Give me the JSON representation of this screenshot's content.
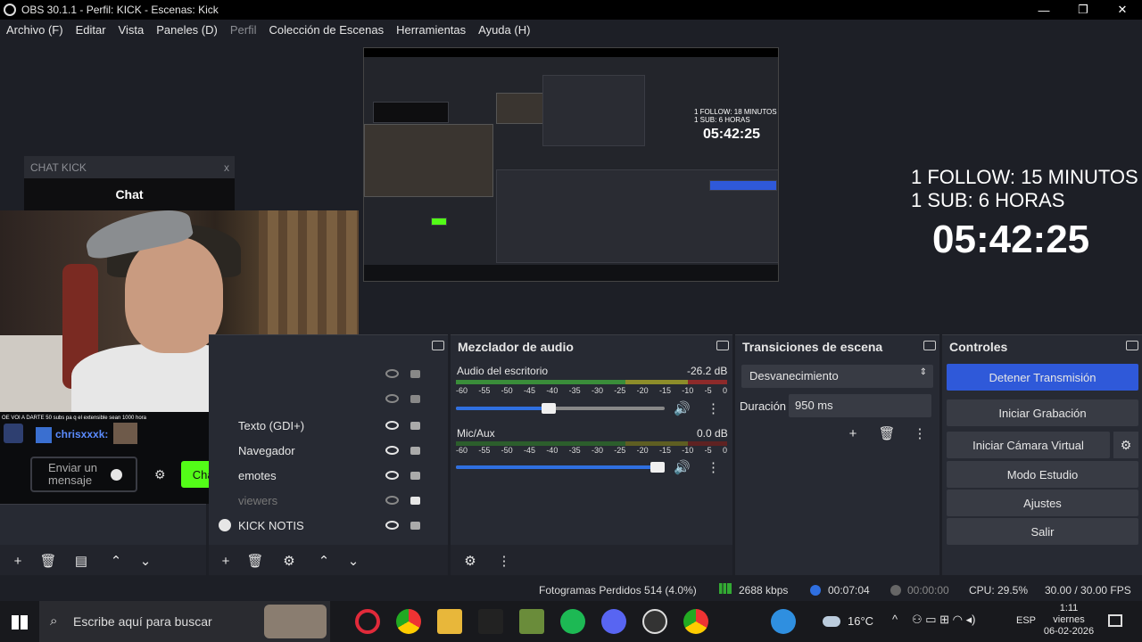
{
  "window": {
    "title": "OBS 30.1.1 - Perfil: KICK - Escenas: Kick",
    "minimize": "—",
    "maximize": "❐",
    "close": "✕"
  },
  "menu": [
    "Archivo (F)",
    "Editar",
    "Vista",
    "Paneles (D)",
    "Perfil",
    "Colección de Escenas",
    "Herramientas",
    "Ayuda (H)"
  ],
  "preview": {
    "inner_follow": "1 FOLLOW: 18 MINUTOS",
    "inner_sub": "1 SUB: 6 HORAS",
    "inner_timer": "05:42:25",
    "follow": "1 FOLLOW: 15 MINUTOS",
    "sub": "1 SUB: 6 HORAS",
    "timer": "05:42:25",
    "chat_header": "CHAT KICK",
    "chat_close": "x",
    "chat_title": "Chat",
    "chat_message": "OE VOI A DARTE 50 subs pa q el extensible sean 1000 hora",
    "chat_user": "chrisxxxk:",
    "chat_input_placeholder": "Enviar un mensaje",
    "chat_button": "Chat"
  },
  "sources": {
    "items": [
      {
        "name": "Texto (GDI+)",
        "visible": true
      },
      {
        "name": "Navegador",
        "visible": true
      },
      {
        "name": "emotes",
        "visible": true
      },
      {
        "name": "viewers",
        "visible": false
      },
      {
        "name": "KICK NOTIS",
        "visible": true
      }
    ]
  },
  "mixer": {
    "title": "Mezclador de audio",
    "scale": [
      "-60",
      "-55",
      "-50",
      "-45",
      "-40",
      "-35",
      "-30",
      "-25",
      "-20",
      "-15",
      "-10",
      "-5",
      "0"
    ],
    "channels": [
      {
        "name": "Audio del escritorio",
        "db": "-26.2 dB",
        "volume": 0.44
      },
      {
        "name": "Mic/Aux",
        "db": "0.0 dB",
        "volume": 1.0
      }
    ]
  },
  "transitions": {
    "title": "Transiciones de escena",
    "selected": "Desvanecimiento",
    "duration_label": "Duración",
    "duration_value": "950 ms"
  },
  "controls": {
    "title": "Controles",
    "stop_stream": "Detener Transmisión",
    "start_recording": "Iniciar Grabación",
    "virtual_cam": "Iniciar Cámara Virtual",
    "studio_mode": "Modo Estudio",
    "settings": "Ajustes",
    "exit": "Salir"
  },
  "status": {
    "dropped": "Fotogramas Perdidos 514 (4.0%)",
    "bitrate": "2688 kbps",
    "stream_time": "00:07:04",
    "rec_time": "00:00:00",
    "cpu": "CPU: 29.5%",
    "fps": "30.00 / 30.00 FPS"
  },
  "taskbar": {
    "search_placeholder": "Escribe aquí para buscar",
    "weather": "16°C",
    "lang": "ESP",
    "time": "1:11",
    "day": "viernes",
    "date": "06-02-2026"
  },
  "colors": {
    "accent_blue": "#2f59d9",
    "kick_green": "#53fc18"
  }
}
